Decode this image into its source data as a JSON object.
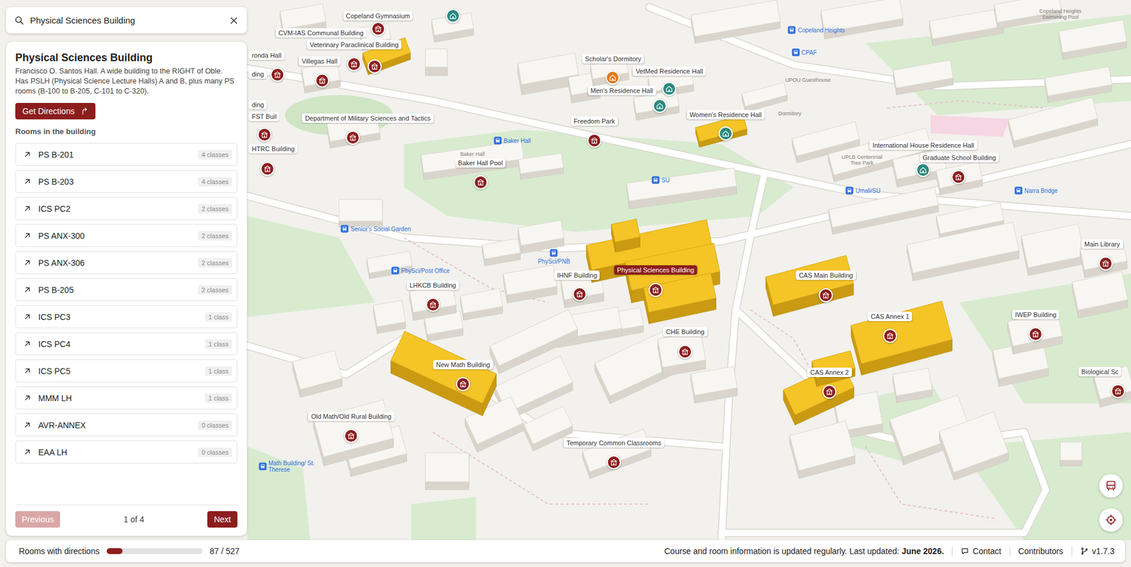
{
  "search": {
    "value": "Physical Sciences Building"
  },
  "panel": {
    "title": "Physical Sciences Building",
    "description": "Francisco O. Santos Hall. A wide building to the RIGHT of Oble. Has PSLH (Physical Science Lecture Halls) A and B, plus many PS rooms (B-100 to B-205, C-101 to C-320).",
    "directions_button": "Get Directions",
    "rooms_heading": "Rooms in the building",
    "rooms": [
      {
        "name": "PS B-201",
        "count": "4 classes"
      },
      {
        "name": "PS B-203",
        "count": "4 classes"
      },
      {
        "name": "ICS PC2",
        "count": "2 classes"
      },
      {
        "name": "PS ANX-300",
        "count": "2 classes"
      },
      {
        "name": "PS ANX-306",
        "count": "2 classes"
      },
      {
        "name": "PS B-205",
        "count": "2 classes"
      },
      {
        "name": "ICS PC3",
        "count": "1 class"
      },
      {
        "name": "ICS PC4",
        "count": "1 class"
      },
      {
        "name": "ICS PC5",
        "count": "1 class"
      },
      {
        "name": "MMM LH",
        "count": "1 class"
      },
      {
        "name": "AVR-ANNEX",
        "count": "0 classes"
      },
      {
        "name": "EAA LH",
        "count": "0 classes"
      }
    ],
    "pagination": {
      "previous": "Previous",
      "previous_disabled": true,
      "page": "1 of 4",
      "next": "Next",
      "next_disabled": false
    }
  },
  "map": {
    "places": [
      {
        "name": "Copeland Gymnasium",
        "kind": "residence",
        "highlighted": false,
        "selected": false
      },
      {
        "name": "CVM-IAS Communal Building",
        "kind": "building",
        "highlighted": false,
        "selected": false
      },
      {
        "name": "Veterinary Paraclinical Building",
        "kind": "building",
        "highlighted": true,
        "selected": false
      },
      {
        "name": "Villegas Hall",
        "kind": "building",
        "highlighted": false,
        "selected": false
      },
      {
        "name": "ronda Hall",
        "kind": "building",
        "highlighted": false,
        "selected": false
      },
      {
        "name": "ding",
        "kind": "building",
        "highlighted": false,
        "selected": false
      },
      {
        "name": "ding",
        "kind": "building",
        "highlighted": false,
        "selected": false
      },
      {
        "name": "FST Buil",
        "kind": "building",
        "highlighted": false,
        "selected": false
      },
      {
        "name": "HTRC Building",
        "kind": "building",
        "highlighted": false,
        "selected": false
      },
      {
        "name": "Department of Military Sciences and Tactics",
        "kind": "building",
        "highlighted": false,
        "selected": false
      },
      {
        "name": "Scholar's Dormitory",
        "kind": "dormitory",
        "highlighted": false,
        "selected": false
      },
      {
        "name": "VetMed Residence Hall",
        "kind": "residence",
        "highlighted": false,
        "selected": false
      },
      {
        "name": "Men's Residence Hall",
        "kind": "residence",
        "highlighted": false,
        "selected": false
      },
      {
        "name": "Women's Residence Hall",
        "kind": "residence",
        "highlighted": true,
        "selected": false
      },
      {
        "name": "Freedom Park",
        "kind": "building",
        "highlighted": false,
        "selected": false
      },
      {
        "name": "Baker Hall Pool",
        "kind": "building",
        "highlighted": false,
        "selected": false
      },
      {
        "name": "International House Residence Hall",
        "kind": "residence",
        "highlighted": false,
        "selected": false
      },
      {
        "name": "Graduate School Building",
        "kind": "building",
        "highlighted": false,
        "selected": false
      },
      {
        "name": "Main Library",
        "kind": "building",
        "highlighted": false,
        "selected": false
      },
      {
        "name": "LHKCB Building",
        "kind": "building",
        "highlighted": false,
        "selected": false
      },
      {
        "name": "IHNF Building",
        "kind": "building",
        "highlighted": false,
        "selected": false
      },
      {
        "name": "Physical Sciences Building",
        "kind": "building",
        "highlighted": true,
        "selected": true
      },
      {
        "name": "CAS Main Building",
        "kind": "building",
        "highlighted": true,
        "selected": false
      },
      {
        "name": "CAS Annex 1",
        "kind": "building",
        "highlighted": true,
        "selected": false
      },
      {
        "name": "IWEP Building",
        "kind": "building",
        "highlighted": false,
        "selected": false
      },
      {
        "name": "CHE Building",
        "kind": "building",
        "highlighted": false,
        "selected": false
      },
      {
        "name": "Biological Sc",
        "kind": "building",
        "highlighted": false,
        "selected": false
      },
      {
        "name": "CAS Annex 2",
        "kind": "building",
        "highlighted": true,
        "selected": false
      },
      {
        "name": "New Math Building",
        "kind": "building",
        "highlighted": true,
        "selected": false
      },
      {
        "name": "Old Math/Old Rural Building",
        "kind": "building",
        "highlighted": false,
        "selected": false
      },
      {
        "name": "Temporary Common Classrooms",
        "kind": "building",
        "highlighted": false,
        "selected": false
      }
    ],
    "transit_stops": [
      {
        "name": "Copeland Heights"
      },
      {
        "name": "CPAF"
      },
      {
        "name": "Baker Hall"
      },
      {
        "name": "SU"
      },
      {
        "name": "Umali/SU"
      },
      {
        "name": "Narra Bridge"
      },
      {
        "name": "Senior's Social Garden"
      },
      {
        "name": "PhySci/PNB"
      },
      {
        "name": "PhySci/Post Office"
      },
      {
        "name": "Math Building/ St. Therese"
      }
    ],
    "minor_labels": [
      "Copeland Heights Swimming Pool",
      "UPOU Guesthouse",
      "Dormitory",
      "UPLB Centennial Tree Park",
      "Baker Hall"
    ]
  },
  "status_bar": {
    "progress_label": "Rooms with directions",
    "level": 0.165,
    "progress_text": "87 / 527",
    "update_text": "Course and room information is updated regularly. Last updated:",
    "update_date": "June 2026.",
    "links": [
      "Contact",
      "Contributors"
    ],
    "version": "v1.7.3"
  }
}
